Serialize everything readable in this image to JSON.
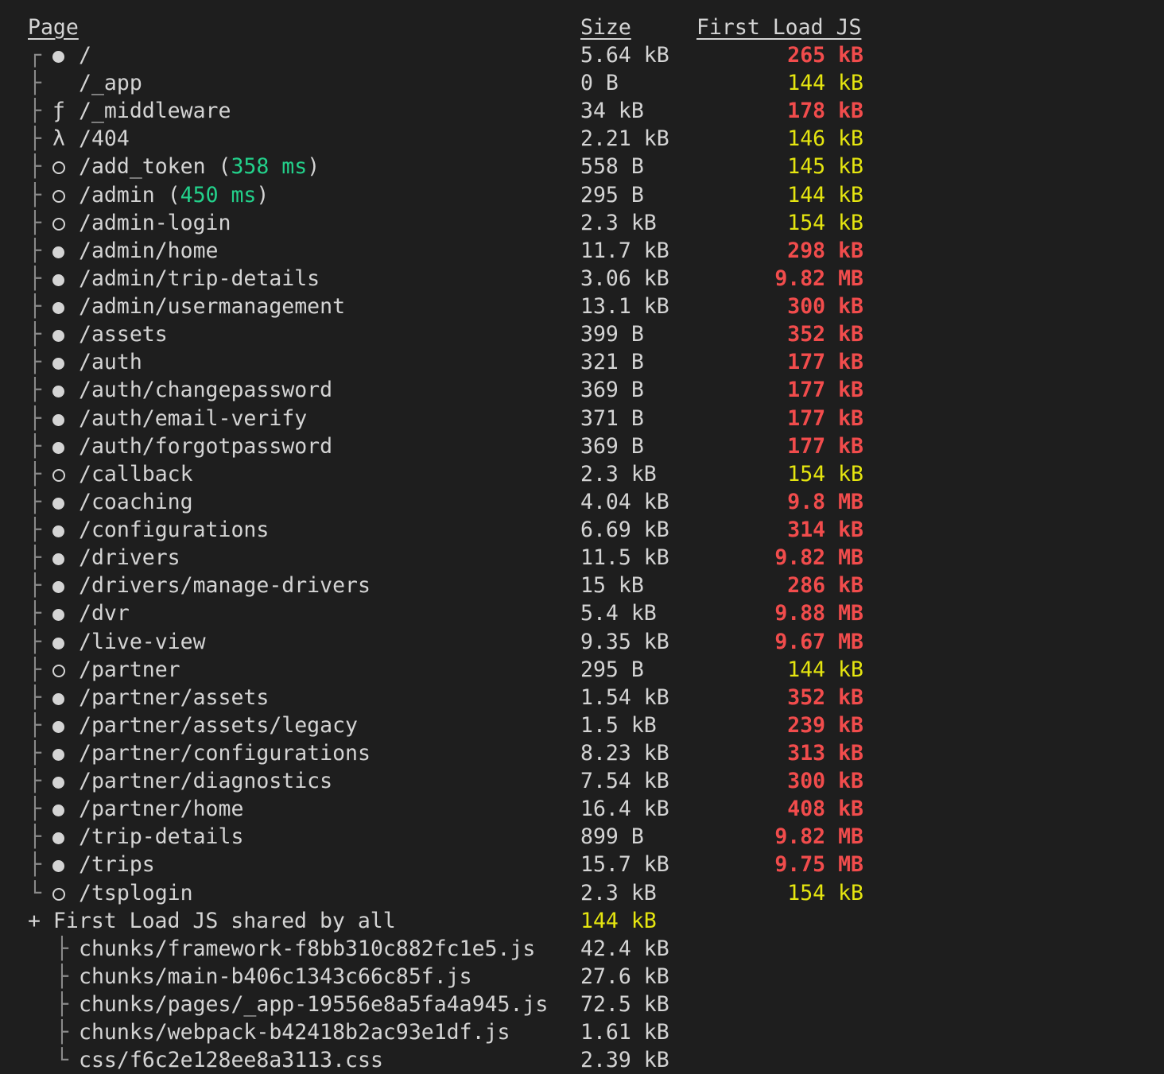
{
  "header": {
    "page_label": "Page",
    "size_label": "Size",
    "first_load_label": "First Load JS"
  },
  "legend_colors": {
    "red": "#f14c4c",
    "yellow": "#e5e510",
    "green": "#23d18b"
  },
  "routes": [
    {
      "tree": "┌",
      "symbol": "ssg-dot",
      "route": "/",
      "size": "5.64 kB",
      "first_load": "265 kB",
      "first_load_color": "red"
    },
    {
      "tree": "├",
      "symbol": "none",
      "route": "/_app",
      "size": "0 B",
      "first_load": "144 kB",
      "first_load_color": "yellow"
    },
    {
      "tree": "├",
      "symbol": "middleware-f",
      "route": "/_middleware",
      "size": "34 kB",
      "first_load": "178 kB",
      "first_load_color": "red"
    },
    {
      "tree": "├",
      "symbol": "lambda",
      "route": "/404",
      "size": "2.21 kB",
      "first_load": "146 kB",
      "first_load_color": "yellow"
    },
    {
      "tree": "├",
      "symbol": "static-circle",
      "route": "/add_token",
      "timing": "358 ms",
      "size": "558 B",
      "first_load": "145 kB",
      "first_load_color": "yellow"
    },
    {
      "tree": "├",
      "symbol": "static-circle",
      "route": "/admin",
      "timing": "450 ms",
      "size": "295 B",
      "first_load": "144 kB",
      "first_load_color": "yellow"
    },
    {
      "tree": "├",
      "symbol": "static-circle",
      "route": "/admin-login",
      "size": "2.3 kB",
      "first_load": "154 kB",
      "first_load_color": "yellow"
    },
    {
      "tree": "├",
      "symbol": "ssg-dot",
      "route": "/admin/home",
      "size": "11.7 kB",
      "first_load": "298 kB",
      "first_load_color": "red"
    },
    {
      "tree": "├",
      "symbol": "ssg-dot",
      "route": "/admin/trip-details",
      "size": "3.06 kB",
      "first_load": "9.82 MB",
      "first_load_color": "red"
    },
    {
      "tree": "├",
      "symbol": "ssg-dot",
      "route": "/admin/usermanagement",
      "size": "13.1 kB",
      "first_load": "300 kB",
      "first_load_color": "red"
    },
    {
      "tree": "├",
      "symbol": "ssg-dot",
      "route": "/assets",
      "size": "399 B",
      "first_load": "352 kB",
      "first_load_color": "red"
    },
    {
      "tree": "├",
      "symbol": "ssg-dot",
      "route": "/auth",
      "size": "321 B",
      "first_load": "177 kB",
      "first_load_color": "red"
    },
    {
      "tree": "├",
      "symbol": "ssg-dot",
      "route": "/auth/changepassword",
      "size": "369 B",
      "first_load": "177 kB",
      "first_load_color": "red"
    },
    {
      "tree": "├",
      "symbol": "ssg-dot",
      "route": "/auth/email-verify",
      "size": "371 B",
      "first_load": "177 kB",
      "first_load_color": "red"
    },
    {
      "tree": "├",
      "symbol": "ssg-dot",
      "route": "/auth/forgotpassword",
      "size": "369 B",
      "first_load": "177 kB",
      "first_load_color": "red"
    },
    {
      "tree": "├",
      "symbol": "static-circle",
      "route": "/callback",
      "size": "2.3 kB",
      "first_load": "154 kB",
      "first_load_color": "yellow"
    },
    {
      "tree": "├",
      "symbol": "ssg-dot",
      "route": "/coaching",
      "size": "4.04 kB",
      "first_load": "9.8 MB",
      "first_load_color": "red"
    },
    {
      "tree": "├",
      "symbol": "ssg-dot",
      "route": "/configurations",
      "size": "6.69 kB",
      "first_load": "314 kB",
      "first_load_color": "red"
    },
    {
      "tree": "├",
      "symbol": "ssg-dot",
      "route": "/drivers",
      "size": "11.5 kB",
      "first_load": "9.82 MB",
      "first_load_color": "red"
    },
    {
      "tree": "├",
      "symbol": "ssg-dot",
      "route": "/drivers/manage-drivers",
      "size": "15 kB",
      "first_load": "286 kB",
      "first_load_color": "red"
    },
    {
      "tree": "├",
      "symbol": "ssg-dot",
      "route": "/dvr",
      "size": "5.4 kB",
      "first_load": "9.88 MB",
      "first_load_color": "red"
    },
    {
      "tree": "├",
      "symbol": "ssg-dot",
      "route": "/live-view",
      "size": "9.35 kB",
      "first_load": "9.67 MB",
      "first_load_color": "red"
    },
    {
      "tree": "├",
      "symbol": "static-circle",
      "route": "/partner",
      "size": "295 B",
      "first_load": "144 kB",
      "first_load_color": "yellow"
    },
    {
      "tree": "├",
      "symbol": "ssg-dot",
      "route": "/partner/assets",
      "size": "1.54 kB",
      "first_load": "352 kB",
      "first_load_color": "red"
    },
    {
      "tree": "├",
      "symbol": "ssg-dot",
      "route": "/partner/assets/legacy",
      "size": "1.5 kB",
      "first_load": "239 kB",
      "first_load_color": "red"
    },
    {
      "tree": "├",
      "symbol": "ssg-dot",
      "route": "/partner/configurations",
      "size": "8.23 kB",
      "first_load": "313 kB",
      "first_load_color": "red"
    },
    {
      "tree": "├",
      "symbol": "ssg-dot",
      "route": "/partner/diagnostics",
      "size": "7.54 kB",
      "first_load": "300 kB",
      "first_load_color": "red"
    },
    {
      "tree": "├",
      "symbol": "ssg-dot",
      "route": "/partner/home",
      "size": "16.4 kB",
      "first_load": "408 kB",
      "first_load_color": "red"
    },
    {
      "tree": "├",
      "symbol": "ssg-dot",
      "route": "/trip-details",
      "size": "899 B",
      "first_load": "9.82 MB",
      "first_load_color": "red"
    },
    {
      "tree": "├",
      "symbol": "ssg-dot",
      "route": "/trips",
      "size": "15.7 kB",
      "first_load": "9.75 MB",
      "first_load_color": "red"
    },
    {
      "tree": "└",
      "symbol": "static-circle",
      "route": "/tsplogin",
      "size": "2.3 kB",
      "first_load": "154 kB",
      "first_load_color": "yellow"
    }
  ],
  "shared": {
    "label": "+ First Load JS shared by all",
    "size": "144 kB",
    "size_color": "yellow",
    "chunks": [
      {
        "tree": "├",
        "name": "chunks/framework-f8bb310c882fc1e5.js",
        "size": "42.4 kB"
      },
      {
        "tree": "├",
        "name": "chunks/main-b406c1343c66c85f.js",
        "size": "27.6 kB"
      },
      {
        "tree": "├",
        "name": "chunks/pages/_app-19556e8a5fa4a945.js",
        "size": "72.5 kB"
      },
      {
        "tree": "├",
        "name": "chunks/webpack-b42418b2ac93e1df.js",
        "size": "1.61 kB"
      },
      {
        "tree": "└",
        "name": "css/f6c2e128ee8a3113.css",
        "size": "2.39 kB"
      }
    ]
  }
}
